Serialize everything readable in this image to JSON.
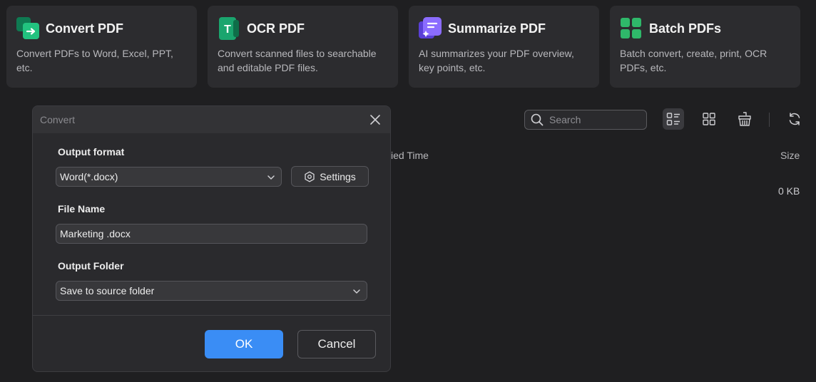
{
  "cards": [
    {
      "title": "Convert PDF",
      "desc": "Convert PDFs to Word, Excel, PPT, etc.",
      "icon": "convert-pdf-icon",
      "color": "#1aa56e"
    },
    {
      "title": "OCR PDF",
      "desc": "Convert scanned files to searchable and editable PDF files.",
      "icon": "ocr-pdf-icon",
      "color": "#1aa56e"
    },
    {
      "title": "Summarize PDF",
      "desc": "AI summarizes your PDF overview, key points, etc.",
      "icon": "summarize-pdf-icon",
      "color": "#7b5cf5"
    },
    {
      "title": "Batch PDFs",
      "desc": "Batch convert, create, print, OCR PDFs, etc.",
      "icon": "batch-pdfs-icon",
      "color": "#2fb86a"
    }
  ],
  "toolbar": {
    "search_placeholder": "Search",
    "icons": [
      "search-icon",
      "list-view-icon",
      "grid-view-icon",
      "clean-icon",
      "refresh-icon"
    ]
  },
  "file_list": {
    "columns": [
      "ied Time",
      "Size"
    ],
    "rows": [
      {
        "size": "0 KB"
      }
    ]
  },
  "dialog": {
    "title": "Convert",
    "output_format_label": "Output format",
    "output_format_value": "Word(*.docx)",
    "settings_label": "Settings",
    "file_name_label": "File Name",
    "file_name_value": "Marketing .docx",
    "output_folder_label": "Output Folder",
    "output_folder_value": "Save to source folder",
    "ok_label": "OK",
    "cancel_label": "Cancel"
  },
  "colors": {
    "background": "#1f1f21",
    "card": "#2c2c2f",
    "accent": "#3a8df5"
  }
}
